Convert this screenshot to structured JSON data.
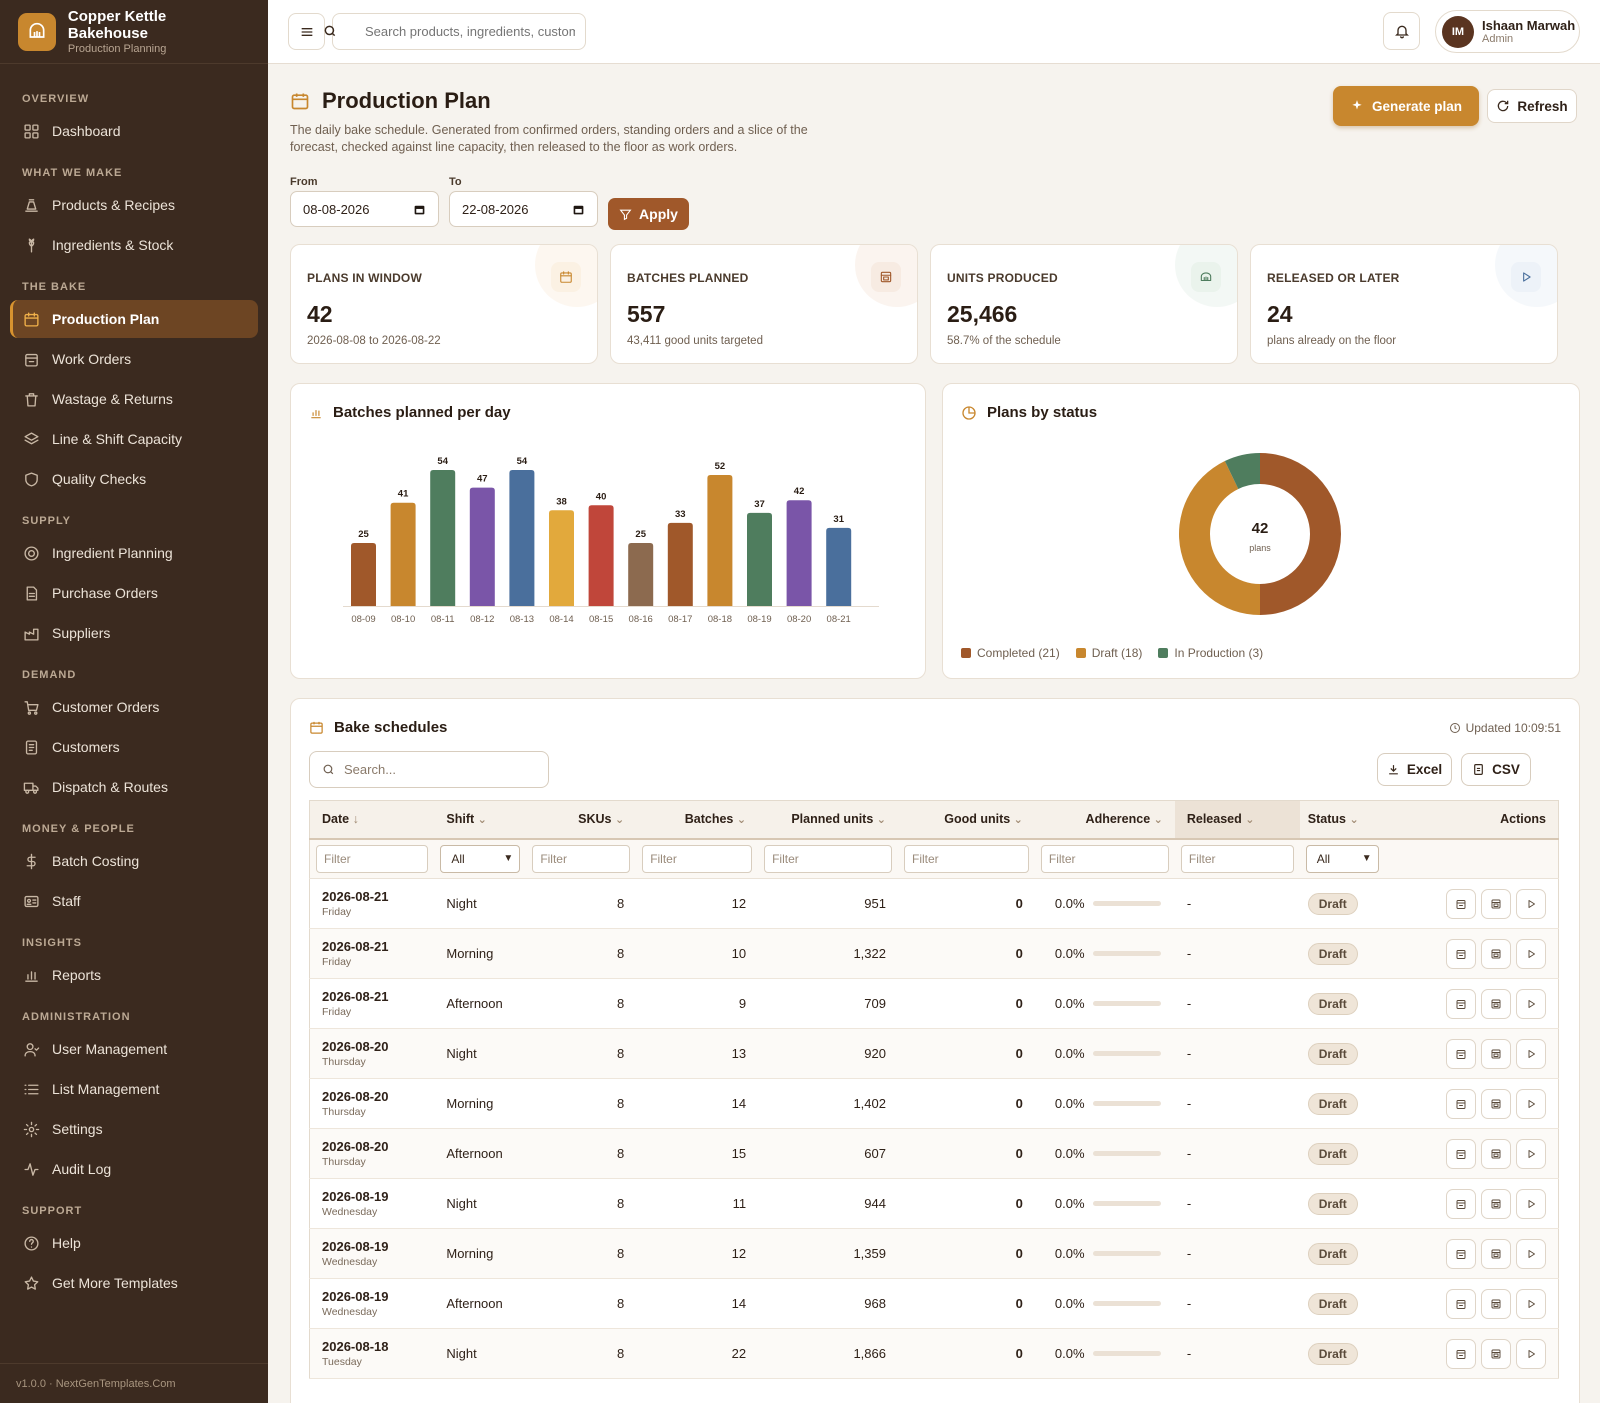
{
  "brand": {
    "name": "Copper Kettle Bakehouse",
    "subtitle": "Production Planning"
  },
  "sidebar": {
    "sections": [
      {
        "title": "OVERVIEW",
        "items": [
          {
            "label": "Dashboard",
            "icon": "dashboard-icon"
          }
        ]
      },
      {
        "title": "WHAT WE MAKE",
        "items": [
          {
            "label": "Products & Recipes",
            "icon": "recipe-icon"
          },
          {
            "label": "Ingredients & Stock",
            "icon": "wheat-icon"
          }
        ]
      },
      {
        "title": "THE BAKE",
        "items": [
          {
            "label": "Production Plan",
            "icon": "calendar-icon",
            "active": true
          },
          {
            "label": "Work Orders",
            "icon": "clipboard-icon"
          },
          {
            "label": "Wastage & Returns",
            "icon": "trash-icon"
          },
          {
            "label": "Line & Shift Capacity",
            "icon": "layers-icon"
          },
          {
            "label": "Quality Checks",
            "icon": "shield-icon"
          }
        ]
      },
      {
        "title": "SUPPLY",
        "items": [
          {
            "label": "Ingredient Planning",
            "icon": "target-icon"
          },
          {
            "label": "Purchase Orders",
            "icon": "document-icon"
          },
          {
            "label": "Suppliers",
            "icon": "factory-icon"
          }
        ]
      },
      {
        "title": "DEMAND",
        "items": [
          {
            "label": "Customer Orders",
            "icon": "cart-icon"
          },
          {
            "label": "Customers",
            "icon": "contacts-icon"
          },
          {
            "label": "Dispatch & Routes",
            "icon": "truck-icon"
          }
        ]
      },
      {
        "title": "MONEY & PEOPLE",
        "items": [
          {
            "label": "Batch Costing",
            "icon": "dollar-icon"
          },
          {
            "label": "Staff",
            "icon": "id-card-icon"
          }
        ]
      },
      {
        "title": "INSIGHTS",
        "items": [
          {
            "label": "Reports",
            "icon": "bar-chart-icon"
          }
        ]
      },
      {
        "title": "ADMINISTRATION",
        "items": [
          {
            "label": "User Management",
            "icon": "user-icon"
          },
          {
            "label": "List Management",
            "icon": "list-icon"
          },
          {
            "label": "Settings",
            "icon": "gear-icon"
          },
          {
            "label": "Audit Log",
            "icon": "activity-icon"
          }
        ]
      },
      {
        "title": "SUPPORT",
        "items": [
          {
            "label": "Help",
            "icon": "help-icon"
          },
          {
            "label": "Get More Templates",
            "icon": "star-icon"
          }
        ]
      }
    ],
    "footer": "v1.0.0 · NextGenTemplates.Com"
  },
  "topbar": {
    "search_placeholder": "Search products, ingredients, customers",
    "user": {
      "initials": "IM",
      "name": "Ishaan Marwah",
      "role": "Admin"
    }
  },
  "page": {
    "title": "Production Plan",
    "description": "The daily bake schedule. Generated from confirmed orders, standing orders and a slice of the forecast, checked against line capacity, then released to the floor as work orders.",
    "generate_label": "Generate plan",
    "refresh_label": "Refresh",
    "from_label": "From",
    "from_value": "08-08-2026",
    "to_label": "To",
    "to_value": "22-08-2026",
    "apply_label": "Apply"
  },
  "kpis": [
    {
      "label": "PLANS IN WINDOW",
      "value": "42",
      "sub": "2026-08-08 to 2026-08-22",
      "icon": "calendar-icon",
      "color": "#c8872e",
      "tint": "#fbf1e3"
    },
    {
      "label": "BATCHES PLANNED",
      "value": "557",
      "sub": "43,411 good units targeted",
      "icon": "oven-icon",
      "color": "#a0582a",
      "tint": "#f7ebe2"
    },
    {
      "label": "UNITS PRODUCED",
      "value": "25,466",
      "sub": "58.7% of the schedule",
      "icon": "bread-icon",
      "color": "#4f7d5e",
      "tint": "#eaf3ec"
    },
    {
      "label": "RELEASED OR LATER",
      "value": "24",
      "sub": "plans already on the floor",
      "icon": "play-icon",
      "color": "#4a6f9c",
      "tint": "#edf2f8"
    }
  ],
  "bar_card": {
    "title": "Batches planned per day"
  },
  "donut_card": {
    "title": "Plans by status",
    "center_value": "42",
    "center_label": "plans"
  },
  "chart_data": [
    {
      "type": "bar",
      "title": "Batches planned per day",
      "categories": [
        "08-09",
        "08-10",
        "08-11",
        "08-12",
        "08-13",
        "08-14",
        "08-15",
        "08-16",
        "08-17",
        "08-18",
        "08-19",
        "08-20",
        "08-21"
      ],
      "values": [
        25,
        41,
        54,
        47,
        54,
        38,
        40,
        25,
        33,
        52,
        37,
        42,
        31
      ],
      "colors": [
        "#a0582a",
        "#c8872e",
        "#4f7d5e",
        "#7a55a8",
        "#4a6f9c",
        "#e2a93c",
        "#c0463a",
        "#8c6a4f",
        "#a0582a",
        "#c8872e",
        "#4f7d5e",
        "#7a55a8",
        "#4a6f9c"
      ],
      "ylim": [
        0,
        54
      ],
      "grid": false
    },
    {
      "type": "pie",
      "title": "Plans by status",
      "categories": [
        "Completed (21)",
        "Draft (18)",
        "In Production (3)"
      ],
      "values": [
        21,
        18,
        3
      ],
      "colors": [
        "#a0582a",
        "#c8872e",
        "#4f7d5e"
      ],
      "legend": "bottom-left"
    }
  ],
  "table_card": {
    "title": "Bake schedules",
    "updated": "Updated 10:09:51",
    "search_placeholder": "Search...",
    "excel_label": "Excel",
    "csv_label": "CSV",
    "filter_placeholder": "Filter",
    "select_all": "All",
    "headers": {
      "date": "Date",
      "shift": "Shift",
      "skus": "SKUs",
      "batches": "Batches",
      "planned": "Planned units",
      "good": "Good units",
      "adherence": "Adherence",
      "released": "Released",
      "status": "Status",
      "actions": "Actions"
    },
    "rows": [
      {
        "date": "2026-08-21",
        "day": "Friday",
        "shift": "Night",
        "skus": "8",
        "batches": "12",
        "planned": "951",
        "good": "0",
        "adherence": "0.0%",
        "released": "-",
        "status": "Draft"
      },
      {
        "date": "2026-08-21",
        "day": "Friday",
        "shift": "Morning",
        "skus": "8",
        "batches": "10",
        "planned": "1,322",
        "good": "0",
        "adherence": "0.0%",
        "released": "-",
        "status": "Draft"
      },
      {
        "date": "2026-08-21",
        "day": "Friday",
        "shift": "Afternoon",
        "skus": "8",
        "batches": "9",
        "planned": "709",
        "good": "0",
        "adherence": "0.0%",
        "released": "-",
        "status": "Draft"
      },
      {
        "date": "2026-08-20",
        "day": "Thursday",
        "shift": "Night",
        "skus": "8",
        "batches": "13",
        "planned": "920",
        "good": "0",
        "adherence": "0.0%",
        "released": "-",
        "status": "Draft"
      },
      {
        "date": "2026-08-20",
        "day": "Thursday",
        "shift": "Morning",
        "skus": "8",
        "batches": "14",
        "planned": "1,402",
        "good": "0",
        "adherence": "0.0%",
        "released": "-",
        "status": "Draft"
      },
      {
        "date": "2026-08-20",
        "day": "Thursday",
        "shift": "Afternoon",
        "skus": "8",
        "batches": "15",
        "planned": "607",
        "good": "0",
        "adherence": "0.0%",
        "released": "-",
        "status": "Draft"
      },
      {
        "date": "2026-08-19",
        "day": "Wednesday",
        "shift": "Night",
        "skus": "8",
        "batches": "11",
        "planned": "944",
        "good": "0",
        "adherence": "0.0%",
        "released": "-",
        "status": "Draft"
      },
      {
        "date": "2026-08-19",
        "day": "Wednesday",
        "shift": "Morning",
        "skus": "8",
        "batches": "12",
        "planned": "1,359",
        "good": "0",
        "adherence": "0.0%",
        "released": "-",
        "status": "Draft"
      },
      {
        "date": "2026-08-19",
        "day": "Wednesday",
        "shift": "Afternoon",
        "skus": "8",
        "batches": "14",
        "planned": "968",
        "good": "0",
        "adherence": "0.0%",
        "released": "-",
        "status": "Draft"
      },
      {
        "date": "2026-08-18",
        "day": "Tuesday",
        "shift": "Night",
        "skus": "8",
        "batches": "22",
        "planned": "1,866",
        "good": "0",
        "adherence": "0.0%",
        "released": "-",
        "status": "Draft"
      }
    ]
  }
}
